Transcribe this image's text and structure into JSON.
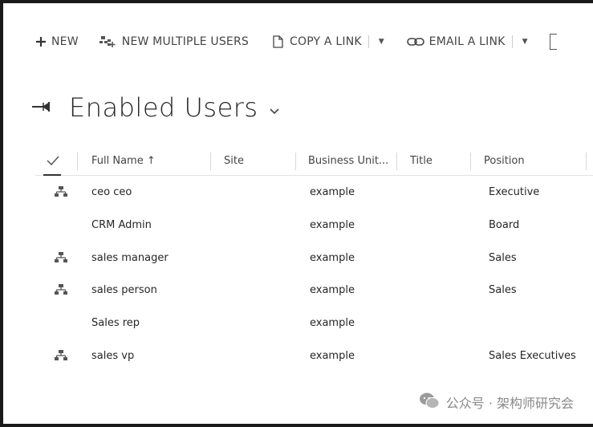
{
  "toolbar": {
    "new_label": "NEW",
    "new_multiple_label": "NEW MULTIPLE USERS",
    "copy_link_label": "COPY A LINK",
    "email_link_label": "EMAIL A LINK"
  },
  "view": {
    "title": "Enabled Users"
  },
  "grid": {
    "columns": {
      "full_name": "Full Name ↑",
      "site": "Site",
      "business_unit": "Business Unit...",
      "title": "Title",
      "position": "Position"
    },
    "rows": [
      {
        "name": "ceo ceo",
        "site": "",
        "business_unit": "example",
        "title": "",
        "position": "Executive",
        "icon": "hierarchy-icon"
      },
      {
        "name": "CRM Admin",
        "site": "",
        "business_unit": "example",
        "title": "",
        "position": "Board",
        "icon": ""
      },
      {
        "name": "sales manager",
        "site": "",
        "business_unit": "example",
        "title": "",
        "position": "Sales",
        "icon": "hierarchy-icon"
      },
      {
        "name": "sales person",
        "site": "",
        "business_unit": "example",
        "title": "",
        "position": "Sales",
        "icon": "hierarchy-icon"
      },
      {
        "name": "Sales rep",
        "site": "",
        "business_unit": "example",
        "title": "",
        "position": "",
        "icon": ""
      },
      {
        "name": "sales vp",
        "site": "",
        "business_unit": "example",
        "title": "",
        "position": "Sales Executives",
        "icon": "hierarchy-icon"
      }
    ]
  },
  "watermark": {
    "text": "公众号 · 架构师研究会"
  }
}
